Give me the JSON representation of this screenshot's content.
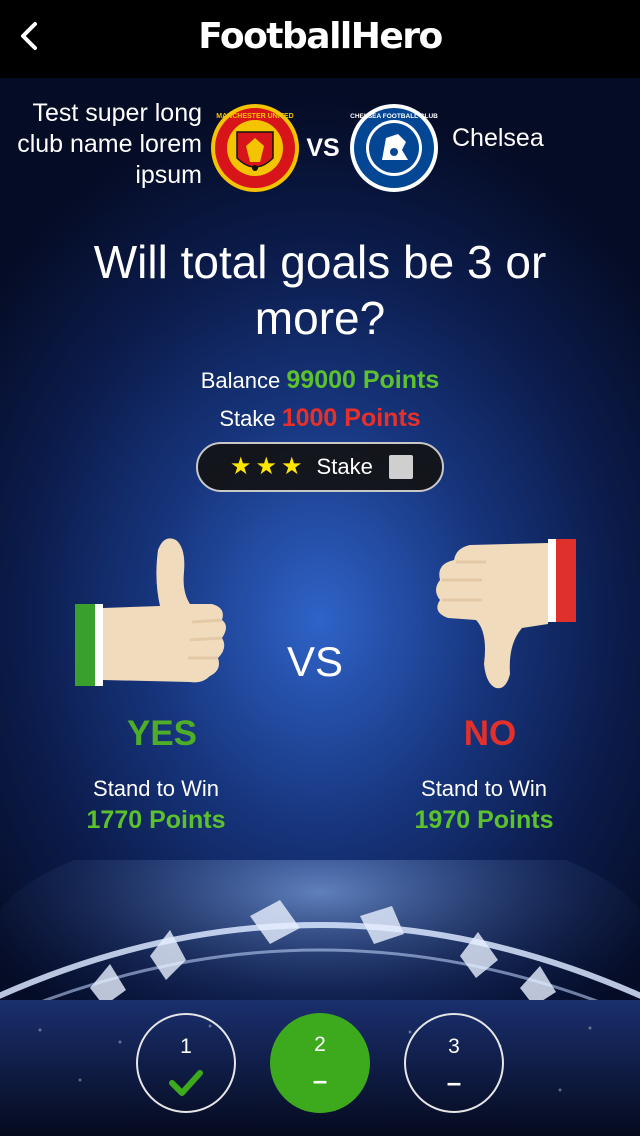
{
  "header": {
    "title": "FootballHero",
    "back_icon": "chevron-left-icon"
  },
  "match": {
    "home_team": "Test super long club name lorem ipsum",
    "away_team": "Chelsea",
    "vs_label": "VS",
    "home_crest_text": "MANCHESTER UNITED",
    "away_crest_text": "CHELSEA FOOTBALL CLUB",
    "home_crest_icon": "manchester-united-crest-icon",
    "away_crest_icon": "chelsea-crest-icon"
  },
  "question": "Will total goals be 3 or more?",
  "balance": {
    "label": "Balance",
    "value": "99000 Points"
  },
  "stake": {
    "label": "Stake",
    "value": "1000 Points",
    "button_label": "Stake",
    "stars": 3,
    "checked": false
  },
  "options": {
    "vs_label": "VS",
    "yes": {
      "label": "YES",
      "win_label": "Stand to Win",
      "win_value": "1770 Points",
      "icon": "thumbs-up-icon"
    },
    "no": {
      "label": "NO",
      "win_label": "Stand to Win",
      "win_value": "1970 Points",
      "icon": "thumbs-down-icon"
    }
  },
  "steps": [
    {
      "number": "1",
      "mark": "✔",
      "state": "done"
    },
    {
      "number": "2",
      "mark": "–",
      "state": "current"
    },
    {
      "number": "3",
      "mark": "–",
      "state": "pending"
    }
  ],
  "colors": {
    "green": "#5cc12d",
    "red": "#e8302a",
    "header_bg": "#000000",
    "background": "#17357d",
    "step_active": "#3daa1e"
  }
}
